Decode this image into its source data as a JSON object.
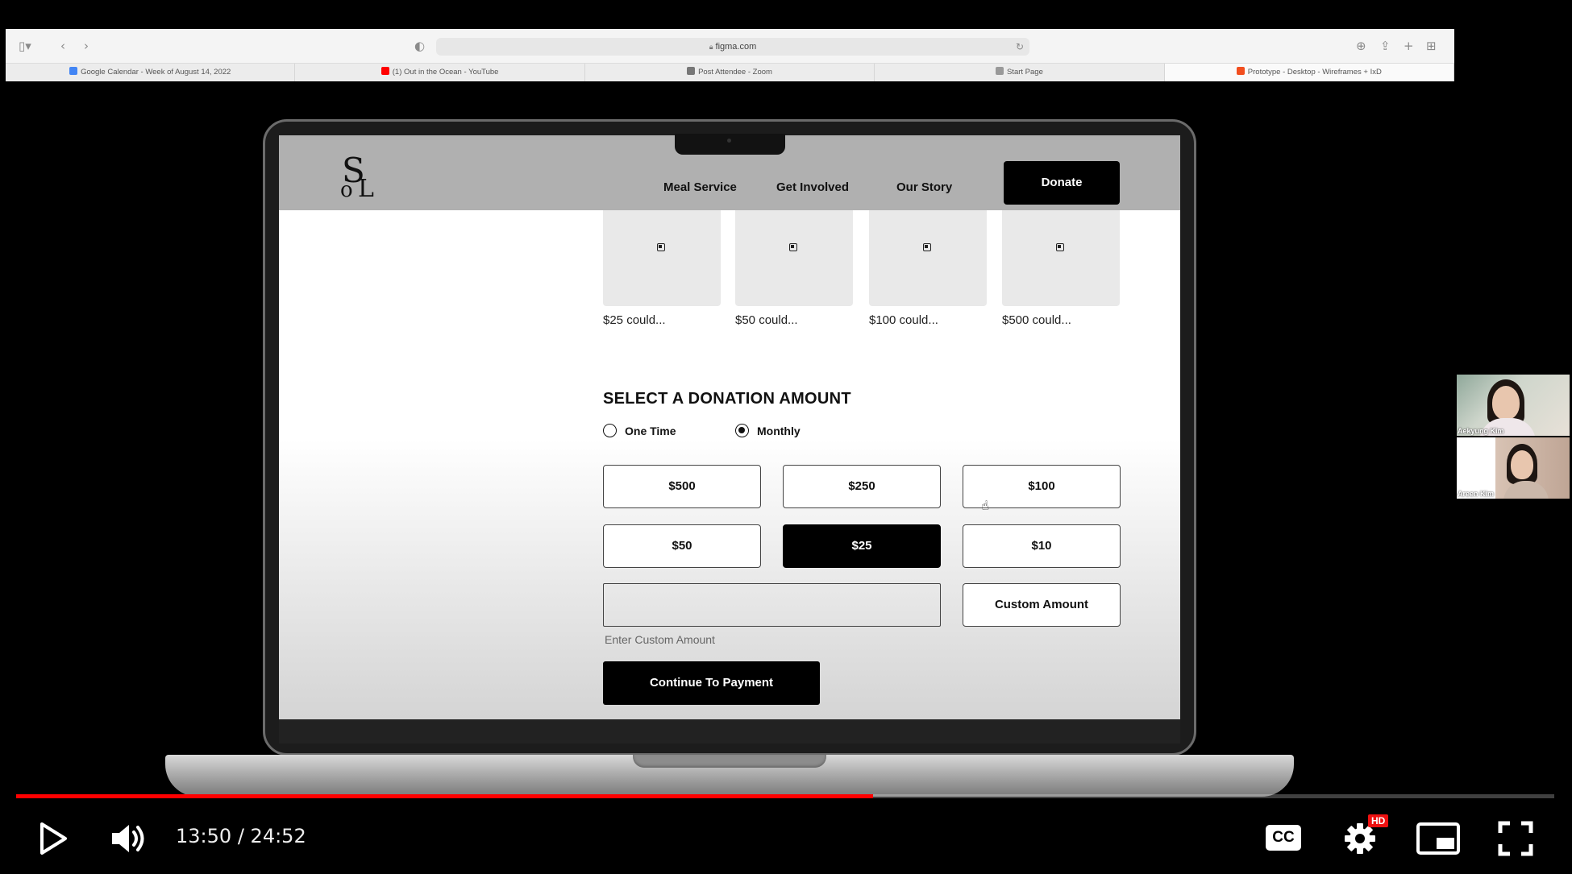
{
  "browser": {
    "url": "figma.com",
    "tabs": [
      {
        "label": "Google Calendar - Week of August 14, 2022",
        "fav_color": "#4285f4"
      },
      {
        "label": "(1) Out in the Ocean - YouTube",
        "fav_color": "#ff0000"
      },
      {
        "label": "Post Attendee - Zoom",
        "fav_color": "#777777"
      },
      {
        "label": "Start Page",
        "fav_color": "#999999"
      },
      {
        "label": "Prototype - Desktop - Wireframes + IxD",
        "fav_color": "#f24e1e"
      }
    ]
  },
  "site": {
    "logo_text": "SoL",
    "nav": {
      "meal_service": "Meal Service",
      "get_involved": "Get Involved",
      "our_story": "Our Story",
      "donate": "Donate"
    },
    "tiers": [
      "$25 could...",
      "$50 could...",
      "$100 could...",
      "$500 could..."
    ],
    "donation": {
      "title": "SELECT A DONATION AMOUNT",
      "frequency": {
        "one_time": "One Time",
        "monthly": "Monthly",
        "selected": "Monthly"
      },
      "amounts": [
        "$500",
        "$250",
        "$100",
        "$50",
        "$25",
        "$10"
      ],
      "selected_amount": "$25",
      "custom_button": "Custom Amount",
      "custom_input_value": "",
      "custom_label": "Enter Custom Amount",
      "continue": "Continue To Payment"
    }
  },
  "video_call": {
    "participants": [
      "Aekyung Kim",
      "Areen Kim"
    ]
  },
  "player": {
    "current_time": "13:50",
    "separator": "/",
    "duration": "24:52",
    "progress": 0.557,
    "cc_label": "CC",
    "hd_badge": "HD",
    "accent_color": "#ff0000"
  }
}
